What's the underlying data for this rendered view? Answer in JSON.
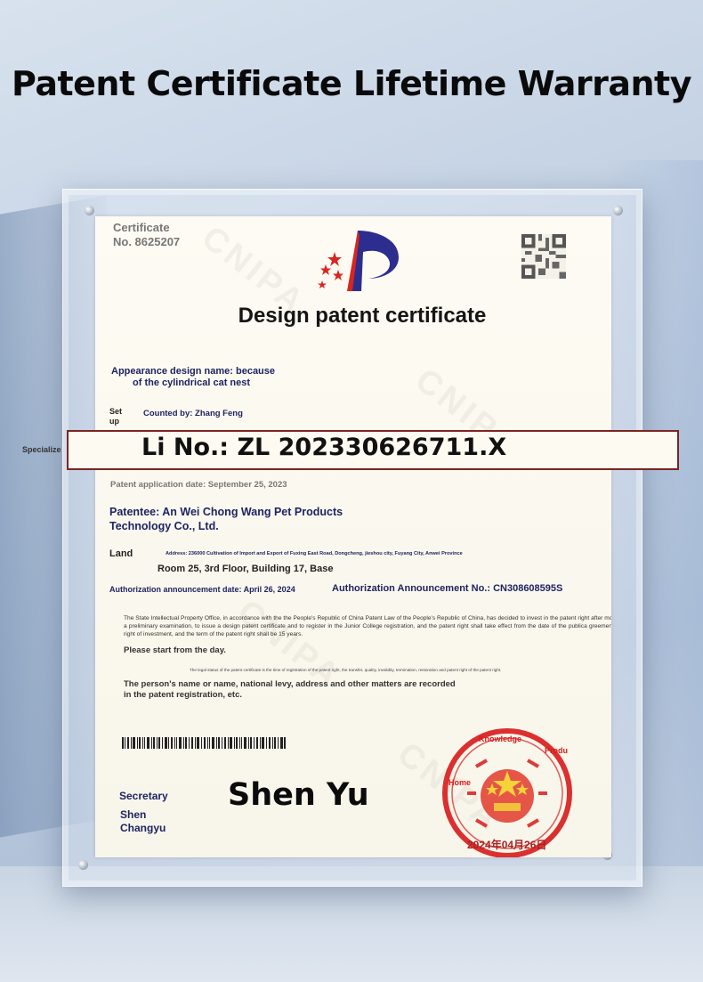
{
  "headline": "Patent Certificate Lifetime Warranty",
  "certificate": {
    "label": "Certificate",
    "number": "No. 8625207",
    "watermark": "CNIPA",
    "title": "Design patent certificate",
    "design_name_line1": "Appearance design name: because",
    "design_name_line2": "of the cylindrical cat nest",
    "setup_label_1": "Set",
    "setup_label_2": "up",
    "counted_by": "Counted by: Zhang Feng",
    "specialize": "Specialize",
    "patent_number": "Li No.: ZL 202330626711.X",
    "application_date": "Patent application date: September 25, 2023",
    "patentee_line1": "Patentee: An Wei Chong Wang Pet Products",
    "patentee_line2": "Technology Co., Ltd.",
    "land_label": "Land",
    "address": "Address: 236000 Cultivation of Import and Export of Fuxing East Road, Dongcheng, jieshou city, Fuyang City, Anwei Province",
    "room": "Room 25, 3rd Floor, Building 17, Base",
    "authorization_date": "Authorization announcement date: April 26, 2024",
    "authorization_no": "Authorization Announcement No.: CN308608595S",
    "body_text": "The State Intellectual Property Office, in accordance with the the People's Republic of China Patent Law of the People's Republic of China, has decided to invest in the patent right after more than a preliminary examination, to issue a design patent certificate and to register in the Junior College registration, and the patent right shall take effect from the date of the publica greement of the right of investment, and the term of the patent right shall be 15 years.",
    "please_start": "Please start from the day.",
    "legal_status": "The legal status of the patent certificate is the time of registration of the patent right, the transfer, quality, invalidity, termination, restoration and patent right of the patent right.",
    "persons_note": "The person's name or name, national levy, address and other matters are recorded in the patent registration, etc.",
    "secretary_label": "Secretary",
    "secretary_name_line1": "Shen",
    "secretary_name_line2": "Changyu",
    "signature": "Shen Yu",
    "seal": {
      "label_knowledge": "Knowledge",
      "label_produ": "Produ",
      "label_home": "Home",
      "date": "2024年04月26日",
      "color": "#d71b1b"
    }
  },
  "colors": {
    "navy_text": "#1e2461",
    "seal_red": "#d71b1b",
    "band_border": "#7c2424"
  }
}
